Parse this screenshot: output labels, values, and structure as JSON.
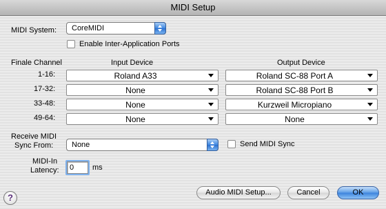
{
  "window": {
    "title": "MIDI Setup"
  },
  "midi_system": {
    "label": "MIDI System:",
    "value": "CoreMIDI"
  },
  "enable_ports": {
    "label": "Enable Inter-Application Ports",
    "checked": false
  },
  "table": {
    "col_channel": "Finale Channel",
    "col_input": "Input Device",
    "col_output": "Output Device",
    "rows": [
      {
        "channel": "1-16:",
        "input": "Roland A33",
        "output": "Roland SC-88 Port A"
      },
      {
        "channel": "17-32:",
        "input": "None",
        "output": "Roland SC-88 Port B"
      },
      {
        "channel": "33-48:",
        "input": "None",
        "output": "Kurzweil Micropiano"
      },
      {
        "channel": "49-64:",
        "input": "None",
        "output": "None"
      }
    ]
  },
  "receive_sync": {
    "label_line1": "Receive MIDI",
    "label_line2": "Sync From:",
    "value": "None"
  },
  "send_sync": {
    "label": "Send MIDI Sync",
    "checked": false
  },
  "latency": {
    "label_line1": "MIDI-In",
    "label_line2": "Latency:",
    "value": "0",
    "unit": "ms"
  },
  "buttons": {
    "audio_setup": "Audio MIDI Setup...",
    "cancel": "Cancel",
    "ok": "OK",
    "help": "?"
  }
}
